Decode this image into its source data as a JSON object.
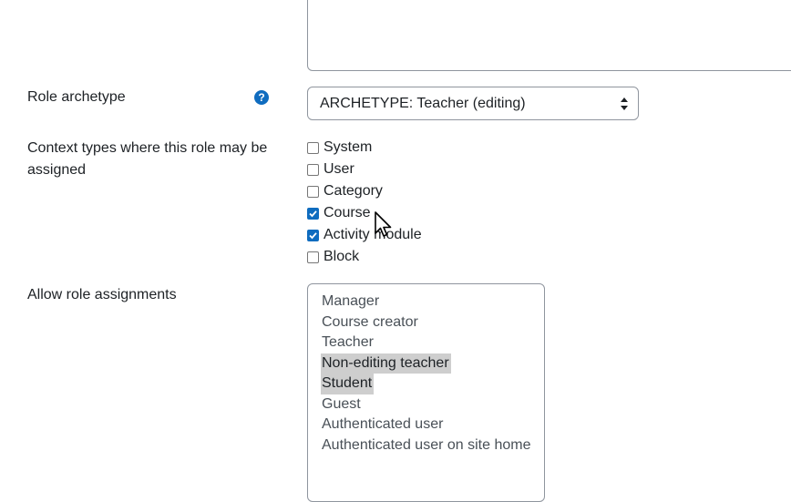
{
  "role_archetype": {
    "label": "Role archetype",
    "help_icon": "question-circle-icon",
    "selected": "ARCHETYPE: Teacher (editing)"
  },
  "context_types": {
    "label": "Context types where this role may be assigned",
    "label_line1": "Context types where this role may be",
    "label_line2": "assigned",
    "options": [
      {
        "label": "System",
        "checked": false
      },
      {
        "label": "User",
        "checked": false
      },
      {
        "label": "Category",
        "checked": false
      },
      {
        "label": "Course",
        "checked": true
      },
      {
        "label": "Activity module",
        "checked": true
      },
      {
        "label": "Block",
        "checked": false
      }
    ]
  },
  "allow_role_assignments": {
    "label": "Allow role assignments",
    "options": [
      {
        "label": "Manager",
        "selected": false
      },
      {
        "label": "Course creator",
        "selected": false
      },
      {
        "label": "Teacher",
        "selected": false
      },
      {
        "label": "Non-editing teacher",
        "selected": true
      },
      {
        "label": "Student",
        "selected": true
      },
      {
        "label": "Guest",
        "selected": false
      },
      {
        "label": "Authenticated user",
        "selected": false
      },
      {
        "label": "Authenticated user on site home",
        "selected": false
      }
    ]
  },
  "colors": {
    "accent": "#0f6cbf",
    "selection": "#cecece",
    "border": "#8f959e"
  }
}
